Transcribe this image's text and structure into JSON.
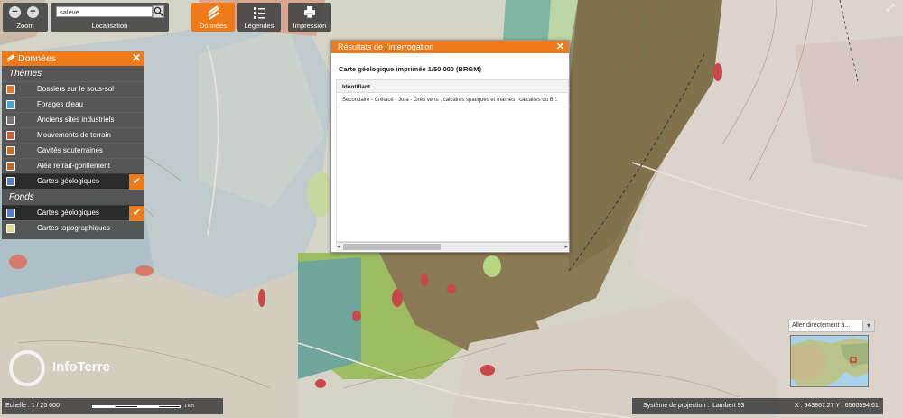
{
  "toolbar": {
    "zoom_label": "Zoom",
    "zoom_out": "−",
    "zoom_in": "+",
    "search_value": "salève",
    "search_label": "Localisation",
    "search_icon": "search-icon",
    "donnees_label": "Données",
    "legendes_label": "Légendes",
    "impression_label": "Impression"
  },
  "data_panel": {
    "title": "Données",
    "close": "✕",
    "themes_title": "Thèmes",
    "themes": [
      {
        "label": "Dossiers sur le sous-sol",
        "icon": "circle-target-icon",
        "checked": false
      },
      {
        "label": "Forages d'eau",
        "icon": "drill-icon",
        "checked": false
      },
      {
        "label": "Anciens sites industriels",
        "icon": "factory-icon",
        "checked": false
      },
      {
        "label": "Mouvements de terrain",
        "icon": "landslide-icon",
        "checked": false
      },
      {
        "label": "Cavités souterraines",
        "icon": "cave-icon",
        "checked": false
      },
      {
        "label": "Aléa retrait-gonflement",
        "icon": "clay-icon",
        "checked": false
      },
      {
        "label": "Cartes géologiques",
        "icon": "geology-map-icon",
        "checked": true
      }
    ],
    "fonds_title": "Fonds",
    "fonds": [
      {
        "label": "Cartes géologiques",
        "icon": "geology-map-icon",
        "checked": true
      },
      {
        "label": "Cartes topographiques",
        "icon": "topo-map-icon",
        "checked": false
      }
    ],
    "check_mark": "✔"
  },
  "result": {
    "title": "Résultats de l'interrogation",
    "close": "✕",
    "subtitle": "Carte géologique imprimée 1/50 000 (BRGM)",
    "column_header": "Identifiant",
    "rows": [
      "Secondaire - Crétacé - Jura - Grès verts ; calcaires spatiques et marnes : calcaires du B..."
    ]
  },
  "logo": {
    "text": "InfoTerre"
  },
  "scale_bar": {
    "label": "Echelle :  1 / 25 000",
    "unit": "1 km"
  },
  "projection_bar": {
    "label": "Système de projection :",
    "value": "Lambert 93",
    "coords": "X : 943867.27  Y : 6560594.61"
  },
  "overview": {
    "goto_label": "Aller directement à..."
  },
  "colors": {
    "accent": "#ef7a1a",
    "panel": "#4e4e4e"
  }
}
